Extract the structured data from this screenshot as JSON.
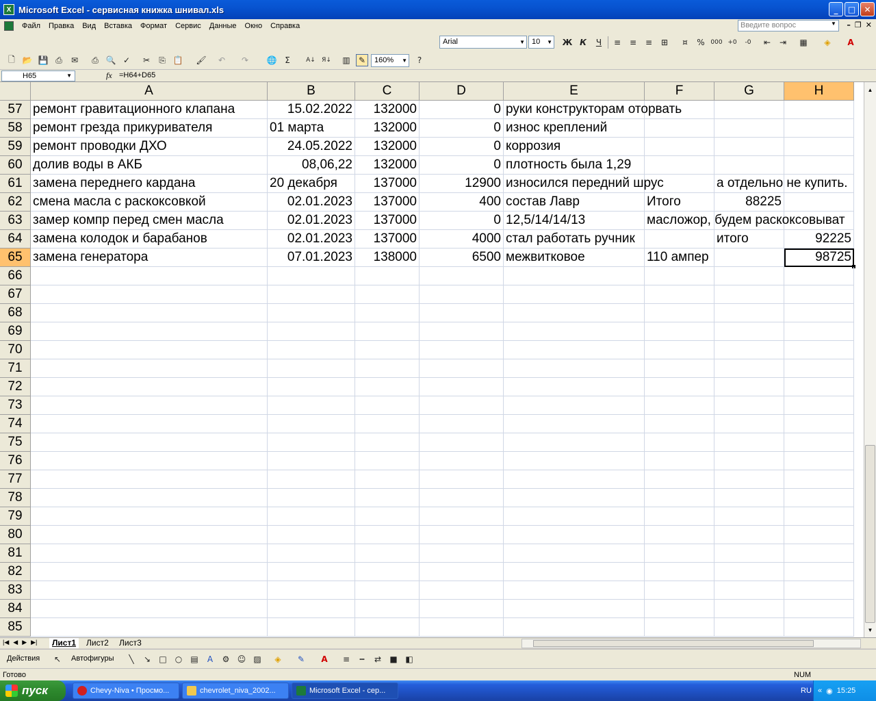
{
  "window": {
    "title": "Microsoft Excel - сервисная книжка шнивал.xls",
    "min": "_",
    "max": "□",
    "close": "✕"
  },
  "menu": {
    "items": [
      "Файл",
      "Правка",
      "Вид",
      "Вставка",
      "Формат",
      "Сервис",
      "Данные",
      "Окно",
      "Справка"
    ],
    "ask_placeholder": "Введите вопрос"
  },
  "toolbar": {
    "font": "Arial",
    "size": "10",
    "zoom": "160%",
    "bold": "Ж",
    "italic": "К",
    "underline": "Ч",
    "sigma": "Σ"
  },
  "formula_bar": {
    "name_box": "H65",
    "fx": "fx",
    "formula": "=H64+D65"
  },
  "sheet": {
    "columns": [
      "A",
      "B",
      "C",
      "D",
      "E",
      "F",
      "G",
      "H"
    ],
    "active_column": "H",
    "active_row": "65",
    "rows": [
      {
        "n": "57",
        "A": "ремонт гравитационного клапана",
        "B": "15.02.2022",
        "C": "132000",
        "D": "0",
        "E": "руки конструкторам оторвать",
        "F": "",
        "G": "",
        "H": ""
      },
      {
        "n": "58",
        "A": "ремонт грезда прикуривателя",
        "B": "01 марта",
        "C": "132000",
        "D": "0",
        "E": "износ креплений",
        "F": "",
        "G": "",
        "H": ""
      },
      {
        "n": "59",
        "A": "ремонт проводки ДХО",
        "B": "24.05.2022",
        "C": "132000",
        "D": "0",
        "E": "коррозия",
        "F": "",
        "G": "",
        "H": ""
      },
      {
        "n": "60",
        "A": "долив воды в АКБ",
        "B": "08,06,22",
        "C": "132000",
        "D": "0",
        "E": "плотность была 1,29",
        "F": "",
        "G": "",
        "H": ""
      },
      {
        "n": "61",
        "A": "замена переднего кардана",
        "B": "20 декабря",
        "C": "137000",
        "D": "12900",
        "E": "износился передний шрус",
        "F": "",
        "G": "а отдельно не купить.",
        "H": ""
      },
      {
        "n": "62",
        "A": "смена масла с раскоксовкой",
        "B": "02.01.2023",
        "C": "137000",
        "D": "400",
        "E": "состав Лавр",
        "F": "Итого",
        "G": "88225",
        "H": ""
      },
      {
        "n": "63",
        "A": "замер компр перед смен масла",
        "B": "02.01.2023",
        "C": "137000",
        "D": "0",
        "E": "12,5/14/14/13",
        "F": "масложор, будем раскоксовыват",
        "G": "",
        "H": ""
      },
      {
        "n": "64",
        "A": "замена колодок и барабанов",
        "B": "02.01.2023",
        "C": "137000",
        "D": "4000",
        "E": "стал работать ручник",
        "F": "",
        "G": "итого",
        "H": "92225"
      },
      {
        "n": "65",
        "A": "замена генератора",
        "B": "07.01.2023",
        "C": "138000",
        "D": "6500",
        "E": "межвитковое",
        "F": "110 ампер",
        "G": "",
        "H": "98725"
      },
      {
        "n": "66"
      },
      {
        "n": "67"
      },
      {
        "n": "68"
      },
      {
        "n": "69"
      },
      {
        "n": "70"
      },
      {
        "n": "71"
      },
      {
        "n": "72"
      },
      {
        "n": "73"
      },
      {
        "n": "74"
      },
      {
        "n": "75"
      },
      {
        "n": "76"
      },
      {
        "n": "77"
      },
      {
        "n": "78"
      },
      {
        "n": "79"
      },
      {
        "n": "80"
      },
      {
        "n": "81"
      },
      {
        "n": "82"
      },
      {
        "n": "83"
      },
      {
        "n": "84"
      },
      {
        "n": "85"
      }
    ]
  },
  "sheet_tabs": [
    "Лист1",
    "Лист2",
    "Лист3"
  ],
  "drawing": {
    "actions": "Действия",
    "autoshapes": "Автофигуры"
  },
  "status": {
    "ready": "Готово",
    "num": "NUM"
  },
  "taskbar": {
    "start": "пуск",
    "tasks": [
      "Chevy-Niva • Просмо...",
      "chevrolet_niva_2002...",
      "Microsoft Excel - сер..."
    ],
    "lang": "RU",
    "clock": "15:25"
  },
  "colors": {
    "title_blue": "#0753d0",
    "selection": "#ffc16e",
    "start_green": "#2f8b2f"
  }
}
